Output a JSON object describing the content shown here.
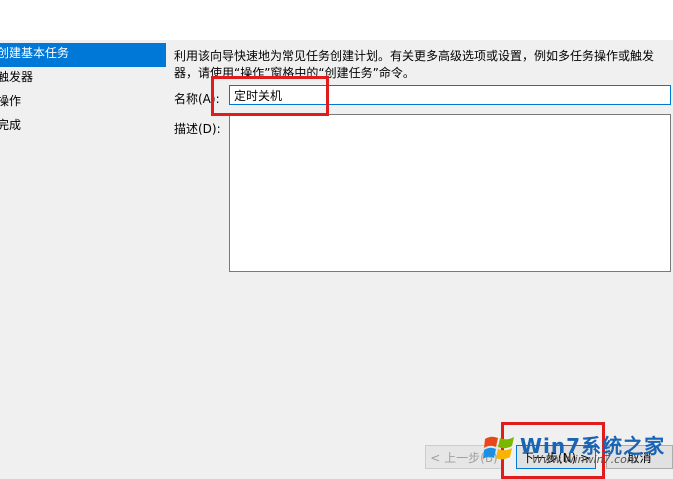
{
  "wizard_steps": [
    {
      "label": "创建基本任务",
      "active": true
    },
    {
      "label": "触发器",
      "active": false
    },
    {
      "label": "操作",
      "active": false
    },
    {
      "label": "完成",
      "active": false
    }
  ],
  "intro_text": "利用该向导快速地为常见任务创建计划。有关更多高级选项或设置，例如多任务操作或触发器，请使用“操作”窗格中的“创建任务”命令。",
  "name_field": {
    "label": "名称(A):",
    "value": "定时关机"
  },
  "description_field": {
    "label": "描述(D):",
    "value": ""
  },
  "buttons": {
    "back": "< 上一步(B)",
    "next": "下一步(N) >",
    "cancel": "取消"
  },
  "watermark": {
    "brand": "Win7系统之家",
    "url": "Www.Winwin7.com"
  },
  "colors": {
    "accent": "#0078d7",
    "highlight": "#e01c1c"
  }
}
